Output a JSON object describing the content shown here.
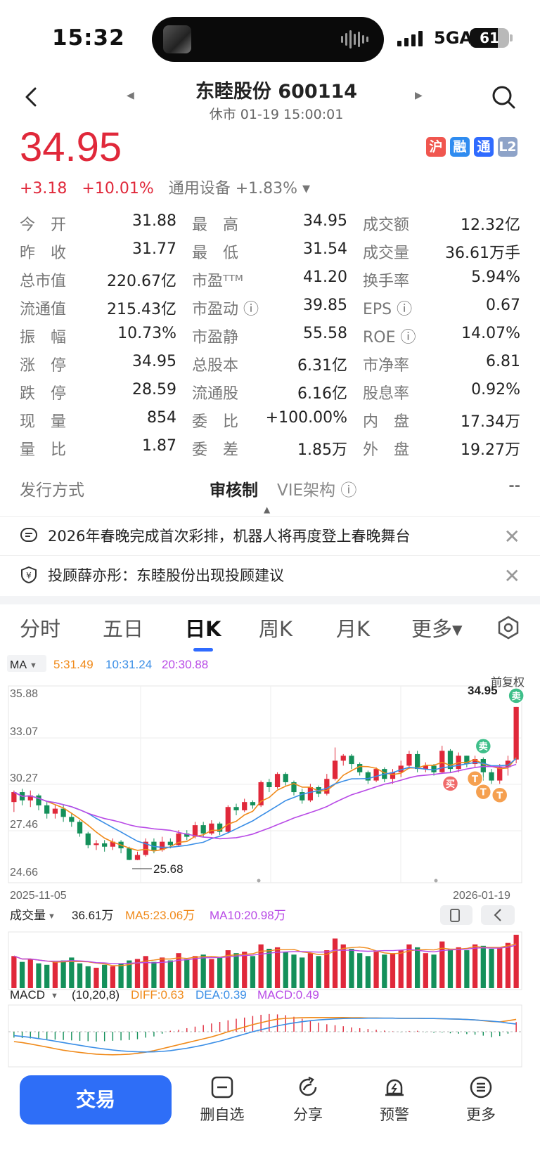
{
  "status_bar": {
    "time": "15:32",
    "network": "5GA",
    "battery": "61"
  },
  "header": {
    "title": "东睦股份 600114",
    "subtitle": "休市 01-19 15:00:01"
  },
  "quote": {
    "price": "34.95",
    "change": "+3.18",
    "change_pct": "+10.01%",
    "sector": "通用设备 +1.83% ▾",
    "badges": [
      {
        "label": "沪",
        "color": "#f0564f"
      },
      {
        "label": "融",
        "color": "#2f8cf0"
      },
      {
        "label": "通",
        "color": "#2f6bff"
      },
      {
        "label": "L2",
        "color": "#8ea3c8"
      }
    ]
  },
  "stats": [
    [
      {
        "label": "今　开",
        "value": "31.88",
        "tone": "red"
      },
      {
        "label": "最　高",
        "value": "34.95",
        "tone": "red"
      },
      {
        "label": "成交额",
        "value": "12.32亿",
        "tone": ""
      }
    ],
    [
      {
        "label": "昨　收",
        "value": "31.77",
        "tone": ""
      },
      {
        "label": "最　低",
        "value": "31.54",
        "tone": "green"
      },
      {
        "label": "成交量",
        "value": "36.61万手",
        "tone": ""
      }
    ],
    [
      {
        "label": "总市值",
        "value": "220.67亿",
        "tone": ""
      },
      {
        "label": "市盈ᵀᵀᴹ",
        "value": "41.20",
        "tone": ""
      },
      {
        "label": "换手率",
        "value": "5.94%",
        "tone": ""
      }
    ],
    [
      {
        "label": "流通值",
        "value": "215.43亿",
        "tone": ""
      },
      {
        "label": "市盈动 ⓘ",
        "value": "39.85",
        "tone": ""
      },
      {
        "label": "EPS ⓘ",
        "value": "0.67",
        "tone": ""
      }
    ],
    [
      {
        "label": "振　幅",
        "value": "10.73%",
        "tone": ""
      },
      {
        "label": "市盈静",
        "value": "55.58",
        "tone": ""
      },
      {
        "label": "ROE ⓘ",
        "value": "14.07%",
        "tone": ""
      }
    ],
    [
      {
        "label": "涨　停",
        "value": "34.95",
        "tone": "red"
      },
      {
        "label": "总股本",
        "value": "6.31亿",
        "tone": ""
      },
      {
        "label": "市净率",
        "value": "6.81",
        "tone": ""
      }
    ],
    [
      {
        "label": "跌　停",
        "value": "28.59",
        "tone": "green"
      },
      {
        "label": "流通股",
        "value": "6.16亿",
        "tone": ""
      },
      {
        "label": "股息率",
        "value": "0.92%",
        "tone": ""
      }
    ],
    [
      {
        "label": "现　量",
        "value": "854",
        "tone": ""
      },
      {
        "label": "委　比",
        "value": "+100.00%",
        "tone": "red"
      },
      {
        "label": "内　盘",
        "value": "17.34万",
        "tone": "green"
      }
    ],
    [
      {
        "label": "量　比",
        "value": "1.87",
        "tone": ""
      },
      {
        "label": "委　差",
        "value": "1.85万",
        "tone": "red"
      },
      {
        "label": "外　盘",
        "value": "19.27万",
        "tone": "red"
      }
    ]
  ],
  "issue": {
    "label": "发行方式",
    "value": "审核制",
    "vie_label": "VIE架构 ⓘ",
    "vie_value": "--"
  },
  "notices": [
    {
      "text": "2026年春晚完成首次彩排，机器人将再度登上春晚舞台"
    },
    {
      "text": "投顾薛亦彤：东睦股份出现投顾建议"
    }
  ],
  "tabs": [
    {
      "label": "分时",
      "active": false
    },
    {
      "label": "五日",
      "active": false
    },
    {
      "label": "日K",
      "active": true
    },
    {
      "label": "周K",
      "active": false
    },
    {
      "label": "月K",
      "active": false
    },
    {
      "label": "更多▾",
      "active": false
    }
  ],
  "chart_data": {
    "type": "candlestick",
    "ma_label": "MA",
    "ma_legend": [
      {
        "text": "5:31.49",
        "color": "#f08a1a"
      },
      {
        "text": "10:31.24",
        "color": "#3a8ee6"
      },
      {
        "text": "20:30.88",
        "color": "#b84ae6"
      }
    ],
    "adjust_label": "前复权",
    "y_ticks": [
      "35.88",
      "33.07",
      "30.27",
      "27.46",
      "24.66"
    ],
    "ylim": [
      24.66,
      35.88
    ],
    "x_start": "2025-11-05",
    "x_end": "2026-01-19",
    "high_label": "34.95",
    "low_label": "25.68",
    "candles": [
      [
        29.2,
        29.8,
        28.6,
        29.9
      ],
      [
        29.8,
        29.3,
        29.0,
        30.0
      ],
      [
        29.3,
        29.6,
        28.9,
        29.9
      ],
      [
        29.6,
        29.0,
        28.7,
        29.7
      ],
      [
        29.0,
        28.5,
        28.2,
        29.2
      ],
      [
        28.5,
        28.8,
        28.2,
        29.0
      ],
      [
        28.8,
        28.3,
        28.0,
        29.0
      ],
      [
        28.3,
        28.0,
        27.7,
        28.5
      ],
      [
        28.0,
        27.3,
        27.1,
        28.1
      ],
      [
        27.3,
        26.6,
        26.4,
        27.4
      ],
      [
        26.6,
        26.7,
        26.3,
        26.9
      ],
      [
        26.7,
        26.5,
        26.2,
        26.9
      ],
      [
        26.5,
        26.8,
        26.3,
        27.0
      ],
      [
        26.8,
        26.4,
        26.1,
        26.9
      ],
      [
        26.4,
        25.7,
        25.68,
        26.5
      ],
      [
        25.7,
        26.0,
        25.68,
        26.2
      ],
      [
        26.0,
        26.8,
        25.9,
        27.0
      ],
      [
        26.8,
        26.3,
        26.1,
        27.0
      ],
      [
        26.3,
        26.8,
        26.2,
        27.1
      ],
      [
        26.8,
        26.6,
        26.4,
        27.0
      ],
      [
        26.6,
        27.3,
        26.5,
        27.5
      ],
      [
        27.3,
        27.1,
        26.9,
        27.5
      ],
      [
        27.1,
        27.8,
        27.0,
        28.0
      ],
      [
        27.8,
        27.3,
        27.1,
        28.0
      ],
      [
        27.3,
        27.9,
        27.2,
        28.1
      ],
      [
        27.9,
        27.4,
        27.2,
        28.0
      ],
      [
        27.4,
        28.9,
        27.3,
        29.0
      ],
      [
        28.9,
        28.7,
        28.4,
        29.1
      ],
      [
        28.7,
        29.2,
        28.6,
        29.4
      ],
      [
        29.2,
        29.0,
        28.8,
        29.3
      ],
      [
        29.0,
        30.4,
        28.9,
        30.5
      ],
      [
        30.4,
        30.1,
        29.8,
        30.6
      ],
      [
        30.1,
        30.9,
        30.0,
        31.0
      ],
      [
        30.9,
        30.4,
        30.2,
        31.0
      ],
      [
        30.4,
        29.8,
        29.6,
        30.5
      ],
      [
        29.8,
        29.3,
        29.1,
        30.0
      ],
      [
        29.3,
        30.1,
        29.2,
        30.3
      ],
      [
        30.1,
        29.7,
        29.5,
        30.2
      ],
      [
        29.7,
        30.6,
        29.6,
        30.9
      ],
      [
        30.6,
        31.7,
        30.5,
        32.5
      ],
      [
        31.7,
        32.0,
        31.4,
        32.1
      ],
      [
        32.0,
        31.5,
        31.2,
        32.1
      ],
      [
        31.5,
        31.0,
        30.8,
        31.6
      ],
      [
        31.0,
        30.5,
        30.3,
        31.1
      ],
      [
        30.5,
        31.2,
        30.4,
        31.3
      ],
      [
        31.2,
        30.6,
        30.4,
        31.3
      ],
      [
        30.6,
        31.0,
        30.3,
        31.2
      ],
      [
        31.0,
        31.4,
        30.7,
        31.7
      ],
      [
        31.4,
        32.1,
        31.2,
        32.3
      ],
      [
        32.1,
        31.2,
        31.0,
        32.3
      ],
      [
        31.2,
        31.4,
        31.0,
        31.6
      ],
      [
        31.4,
        31.0,
        30.8,
        31.5
      ],
      [
        31.0,
        32.3,
        30.9,
        32.6
      ],
      [
        32.3,
        31.2,
        31.0,
        32.4
      ],
      [
        31.2,
        32.0,
        31.0,
        32.2
      ],
      [
        32.0,
        31.5,
        31.3,
        32.0
      ],
      [
        31.5,
        31.8,
        31.3,
        32.0
      ],
      [
        31.8,
        31.0,
        30.5,
        31.9
      ],
      [
        31.0,
        30.5,
        30.3,
        31.2
      ],
      [
        30.5,
        31.3,
        30.3,
        31.5
      ],
      [
        31.3,
        31.7,
        30.8,
        32.0
      ],
      [
        31.77,
        34.95,
        31.54,
        34.95
      ]
    ],
    "trade_marks": [
      {
        "label": "卖",
        "kind": "sell",
        "index": 57
      },
      {
        "label": "卖",
        "kind": "sell",
        "index": 61
      },
      {
        "label": "买",
        "kind": "buy",
        "index": 53
      },
      {
        "label": "T",
        "kind": "t",
        "index": 56
      },
      {
        "label": "T",
        "kind": "t",
        "index": 57
      },
      {
        "label": "T",
        "kind": "t",
        "index": 59
      }
    ],
    "volume": {
      "label": "成交量",
      "value": "36.61万",
      "ma5": "MA5:23.06万",
      "ma10": "MA10:20.98万",
      "bars": [
        22,
        18,
        20,
        17,
        16,
        18,
        19,
        21,
        17,
        15,
        14,
        16,
        15,
        17,
        19,
        20,
        22,
        18,
        21,
        19,
        24,
        20,
        22,
        23,
        20,
        21,
        26,
        24,
        25,
        22,
        30,
        27,
        28,
        25,
        23,
        21,
        24,
        22,
        26,
        34,
        30,
        27,
        24,
        22,
        25,
        23,
        24,
        26,
        30,
        28,
        24,
        23,
        32,
        27,
        28,
        26,
        30,
        29,
        27,
        28,
        31,
        36.61
      ]
    },
    "macd": {
      "label": "MACD",
      "params": "(10,20,8)",
      "diff": "DIFF:0.63",
      "dea": "DEA:0.39",
      "macd": "MACD:0.49",
      "hist": [
        -0.3,
        -0.32,
        -0.34,
        -0.36,
        -0.38,
        -0.4,
        -0.42,
        -0.44,
        -0.46,
        -0.48,
        -0.5,
        -0.48,
        -0.46,
        -0.44,
        -0.42,
        -0.38,
        -0.3,
        -0.24,
        -0.1,
        0.05,
        0.1,
        0.18,
        0.26,
        0.34,
        0.42,
        0.5,
        0.58,
        0.66,
        0.72,
        0.8,
        0.86,
        0.9,
        0.88,
        0.84,
        0.76,
        0.66,
        0.55,
        0.46,
        0.38,
        0.33,
        0.28,
        0.22,
        0.18,
        0.14,
        0.1,
        0.06,
        0.02,
        -0.02,
        0.04,
        0.05,
        -0.02,
        -0.05,
        -0.04,
        -0.08,
        -0.1,
        -0.12,
        -0.15,
        -0.2,
        -0.28,
        -0.22,
        -0.1,
        0.49
      ],
      "dif_line": [
        -0.5,
        -0.55,
        -0.62,
        -0.7,
        -0.78,
        -0.86,
        -0.94,
        -1.0,
        -1.05,
        -1.1,
        -1.14,
        -1.16,
        -1.17,
        -1.16,
        -1.14,
        -1.1,
        -1.04,
        -0.96,
        -0.86,
        -0.76,
        -0.66,
        -0.56,
        -0.46,
        -0.36,
        -0.26,
        -0.14,
        0.0,
        0.12,
        0.24,
        0.36,
        0.46,
        0.56,
        0.64,
        0.68,
        0.7,
        0.71,
        0.72,
        0.72,
        0.72,
        0.72,
        0.72,
        0.71,
        0.71,
        0.7,
        0.7,
        0.69,
        0.69,
        0.68,
        0.68,
        0.68,
        0.67,
        0.67,
        0.66,
        0.65,
        0.64,
        0.62,
        0.6,
        0.56,
        0.52,
        0.5,
        0.56,
        0.63
      ],
      "dea_line": [
        -0.2,
        -0.24,
        -0.29,
        -0.35,
        -0.41,
        -0.48,
        -0.55,
        -0.62,
        -0.69,
        -0.76,
        -0.82,
        -0.88,
        -0.93,
        -0.97,
        -1.0,
        -1.02,
        -1.03,
        -1.02,
        -1.0,
        -0.96,
        -0.9,
        -0.84,
        -0.76,
        -0.68,
        -0.58,
        -0.48,
        -0.36,
        -0.24,
        -0.12,
        0.0,
        0.1,
        0.2,
        0.3,
        0.38,
        0.45,
        0.51,
        0.56,
        0.6,
        0.63,
        0.65,
        0.67,
        0.68,
        0.68,
        0.69,
        0.69,
        0.69,
        0.69,
        0.68,
        0.68,
        0.68,
        0.67,
        0.67,
        0.66,
        0.65,
        0.64,
        0.62,
        0.6,
        0.57,
        0.54,
        0.5,
        0.44,
        0.39
      ]
    }
  },
  "bottom": {
    "trade_label": "交易",
    "actions": [
      {
        "label": "删自选",
        "icon": "remove-watchlist-icon"
      },
      {
        "label": "分享",
        "icon": "share-icon"
      },
      {
        "label": "预警",
        "icon": "alert-icon"
      },
      {
        "label": "更多",
        "icon": "more-icon"
      }
    ]
  }
}
